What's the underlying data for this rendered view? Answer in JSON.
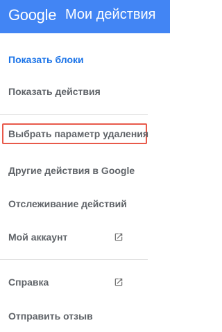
{
  "header": {
    "logo_text": "Google",
    "title": "Мои действия"
  },
  "menu": {
    "show_blocks": "Показать блоки",
    "show_actions": "Показать действия",
    "choose_delete_option": "Выбрать параметр удаления",
    "other_google_activity": "Другие действия в Google",
    "activity_controls": "Отслеживание действий",
    "my_account": "Мой аккаунт",
    "help": "Справка",
    "send_feedback": "Отправить отзыв"
  },
  "icons": {
    "external_link": "open-in-new-icon"
  },
  "colors": {
    "header_bg": "#4285f4",
    "active_link": "#1a73e8",
    "highlight_border": "#e8594a",
    "text": "#5f6368"
  }
}
